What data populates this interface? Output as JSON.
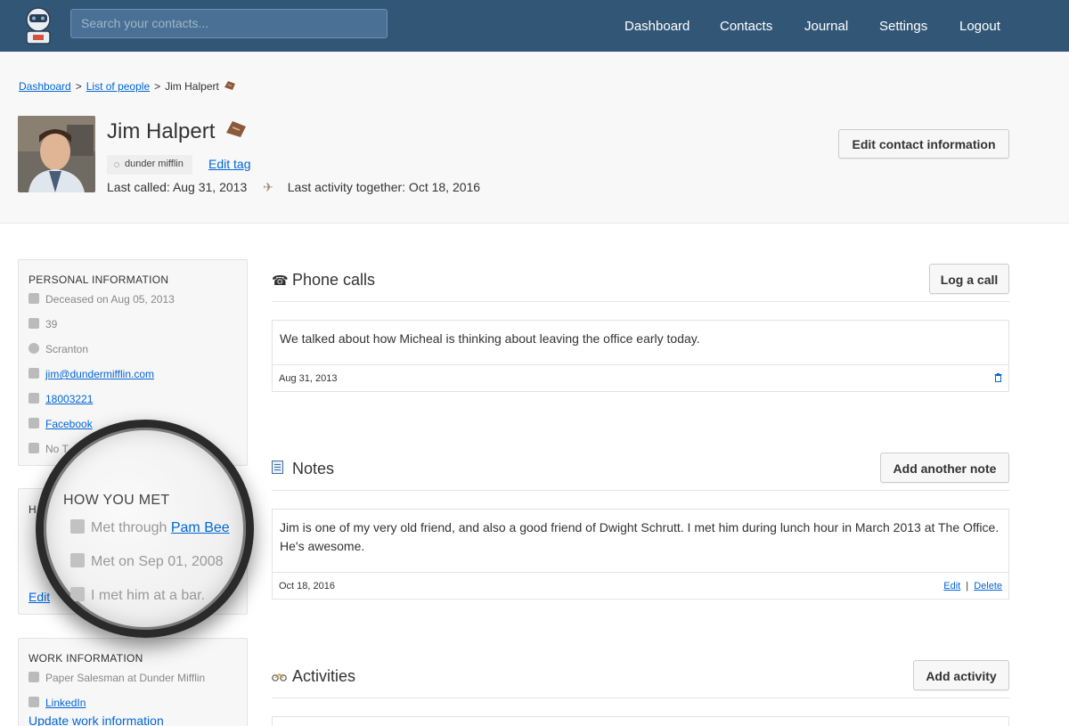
{
  "nav": {
    "search_placeholder": "Search your contacts...",
    "links": [
      "Dashboard",
      "Contacts",
      "Journal",
      "Settings",
      "Logout"
    ]
  },
  "breadcrumb": {
    "items": [
      "Dashboard",
      "List of people"
    ],
    "current": "Jim Halpert",
    "separator": ">"
  },
  "contact": {
    "name": "Jim Halpert",
    "tag": "dunder mifflin",
    "edit_tag": "Edit tag",
    "last_called": "Last called: Aug 31, 2013",
    "last_activity": "Last activity together: Oct 18, 2016",
    "edit_button": "Edit contact information"
  },
  "personal": {
    "title": "PERSONAL INFORMATION",
    "deceased": "Deceased on Aug 05, 2013",
    "age": "39",
    "city": "Scranton",
    "email": "jim@dundermifflin.com",
    "phone": "18003221",
    "facebook": "Facebook",
    "twitter": "No T"
  },
  "how_met": {
    "title_short": "H",
    "edit": "Edit",
    "title": "HOW YOU MET",
    "met_through_label": "Met through",
    "met_through_link": "Pam Bee",
    "met_on": "Met on Sep 01, 2008",
    "note": "I met him at a bar."
  },
  "work": {
    "title": "WORK INFORMATION",
    "job": "Paper Salesman at Dunder Mifflin",
    "linkedin": "LinkedIn",
    "update": "Update work information"
  },
  "phone_calls": {
    "title": "Phone calls",
    "button": "Log a call",
    "entry": "We talked about how Micheal is thinking about leaving the office early today.",
    "date": "Aug 31, 2013"
  },
  "notes": {
    "title": "Notes",
    "button": "Add another note",
    "entry": "Jim is one of my very old friend, and also a good friend of Dwight Schrutt. I met him during lunch hour in March 2013 at The Office. He's awesome.",
    "date": "Oct 18, 2016",
    "edit": "Edit",
    "sep": "|",
    "delete": "Delete"
  },
  "activities": {
    "title": "Activities",
    "button": "Add activity"
  },
  "colors": {
    "nav_bg": "#325776",
    "link": "#0366d6",
    "band_bg": "#f8f8f8"
  },
  "icons": [
    "robot-logo",
    "coffin-icon",
    "plane-icon",
    "phone-emoji-icon",
    "notepad-emoji-icon",
    "bicycle-emoji-icon",
    "trash-icon"
  ]
}
